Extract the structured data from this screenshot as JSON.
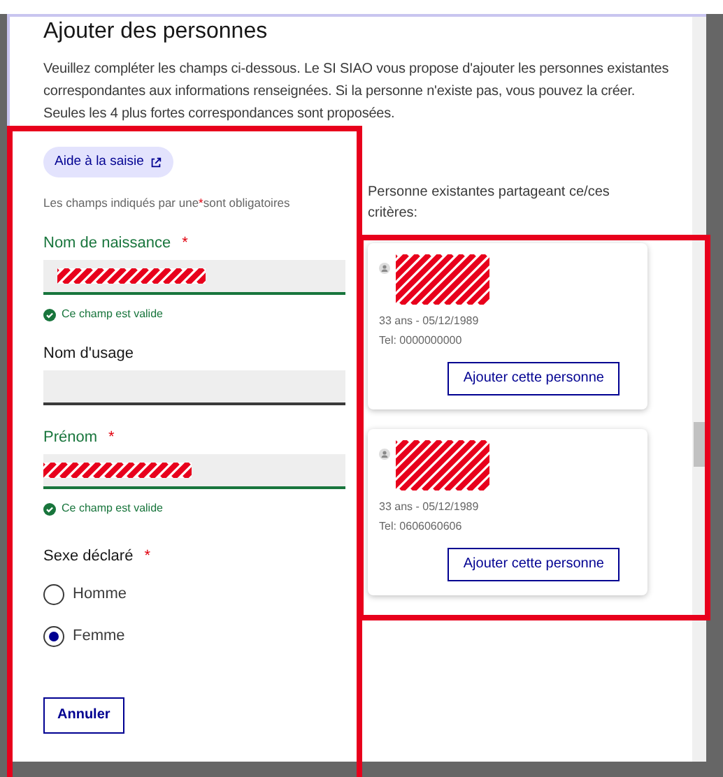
{
  "title": "Ajouter des personnes",
  "intro": "Veuillez compléter les champs ci-dessous. Le SI SIAO vous propose d'ajouter les personnes existantes correspondantes aux informations renseignées. Si la personne n'existe pas, vous pouvez la créer. Seules les 4 plus fortes correspondances sont proposées.",
  "help_link": "Aide à la saisie",
  "required_note": {
    "before": "Les champs indiqués par une",
    "mark": "*",
    "after": "sont obligatoires"
  },
  "fields": [
    {
      "label": "Nom de naissance",
      "required": true,
      "valid": true,
      "redacted": true,
      "validation": "Ce champ est valide"
    },
    {
      "label": "Nom d'usage",
      "required": false,
      "valid": false,
      "redacted": false
    },
    {
      "label": "Prénom",
      "required": true,
      "valid": true,
      "redacted": true,
      "validation": "Ce champ est valide"
    }
  ],
  "sex": {
    "label": "Sexe déclaré",
    "required": true,
    "options": [
      {
        "label": "Homme",
        "selected": false
      },
      {
        "label": "Femme",
        "selected": true
      }
    ]
  },
  "required_mark": "*",
  "cancel_button": "Annuler",
  "matches": {
    "heading": "Personne existantes partageant ce/ces critères:",
    "persons": [
      {
        "age_date": "33 ans - 05/12/1989",
        "phone": "Tel: 0000000000",
        "button": "Ajouter cette personne"
      },
      {
        "age_date": "33 ans - 05/12/1989",
        "phone": "Tel: 0606060606",
        "button": "Ajouter cette personne"
      }
    ]
  }
}
